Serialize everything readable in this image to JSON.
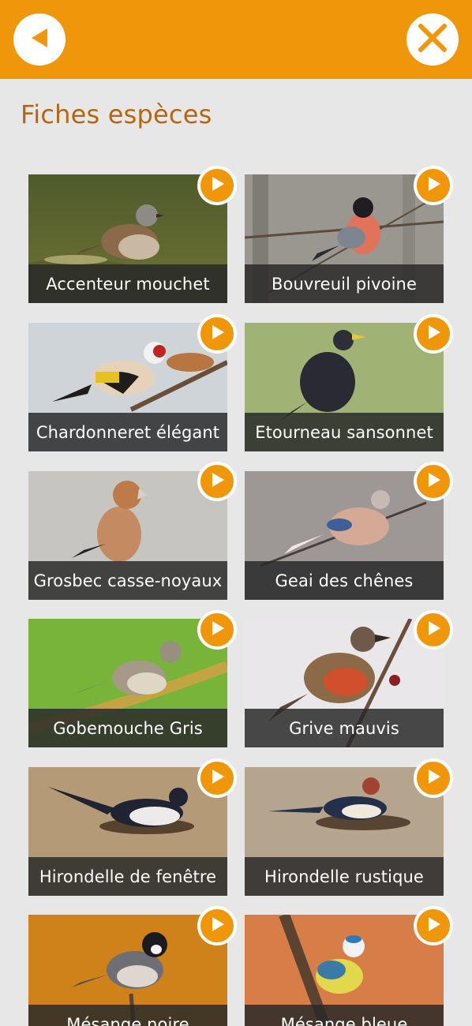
{
  "header": {
    "back_icon": "back-arrow-icon",
    "close_icon": "close-icon",
    "accent_color": "#f0960a"
  },
  "page": {
    "title": "Fiches espèces",
    "title_color": "#b5660f"
  },
  "species": [
    {
      "name": "Accenteur mouchet",
      "play_icon": "play-icon"
    },
    {
      "name": "Bouvreuil pivoine",
      "play_icon": "play-icon"
    },
    {
      "name": "Chardonneret élégant",
      "play_icon": "play-icon"
    },
    {
      "name": "Etourneau sansonnet",
      "play_icon": "play-icon"
    },
    {
      "name": "Grosbec casse-noyaux",
      "play_icon": "play-icon"
    },
    {
      "name": "Geai des chênes",
      "play_icon": "play-icon"
    },
    {
      "name": "Gobemouche Gris",
      "play_icon": "play-icon"
    },
    {
      "name": "Grive mauvis",
      "play_icon": "play-icon"
    },
    {
      "name": "Hirondelle de fenêtre",
      "play_icon": "play-icon"
    },
    {
      "name": "Hirondelle rustique",
      "play_icon": "play-icon"
    },
    {
      "name": "Mésange noire",
      "play_icon": "play-icon"
    },
    {
      "name": "Mésange bleue",
      "play_icon": "play-icon"
    }
  ]
}
